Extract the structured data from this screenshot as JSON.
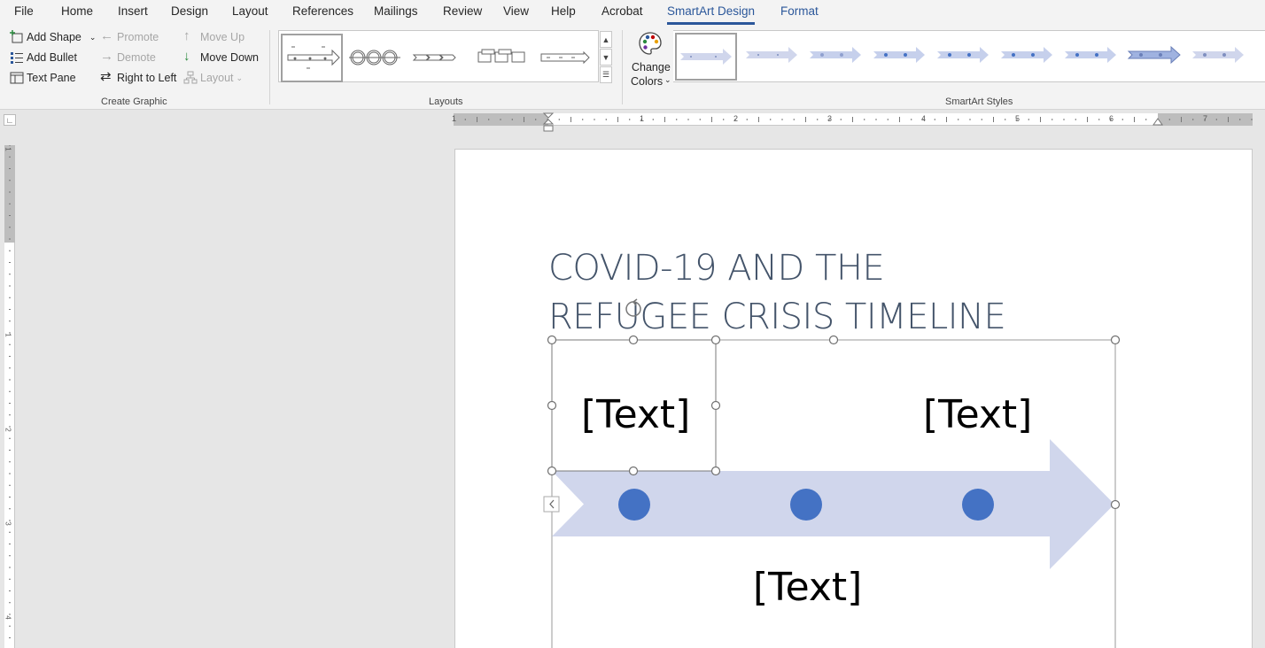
{
  "tabs": [
    "File",
    "Home",
    "Insert",
    "Design",
    "Layout",
    "References",
    "Mailings",
    "Review",
    "View",
    "Help",
    "Acrobat",
    "SmartArt Design",
    "Format"
  ],
  "create_graphic": {
    "add_shape": "Add Shape",
    "add_bullet": "Add Bullet",
    "text_pane": "Text Pane",
    "promote": "Promote",
    "demote": "Demote",
    "right_to_left": "Right to Left",
    "move_up": "Move Up",
    "move_down": "Move Down",
    "layout": "Layout",
    "label": "Create Graphic"
  },
  "layouts": {
    "label": "Layouts"
  },
  "styles": {
    "change_colors_line1": "Change",
    "change_colors_line2": "Colors",
    "label": "SmartArt Styles"
  },
  "ruler": {
    "h_numbers": [
      "1",
      "1",
      "2",
      "3",
      "4",
      "5",
      "6",
      "7"
    ],
    "v_numbers": [
      "1",
      "1",
      "2",
      "3",
      "4"
    ]
  },
  "document": {
    "title_line1": "COVID-19 AND THE",
    "title_line2": "REFUGEE CRISIS TIMELINE",
    "smartart_text": [
      "[Text]",
      "[Text]",
      "[Text]"
    ]
  },
  "colors": {
    "accent": "#2b579a",
    "arrow_fill": "#d0d6ec",
    "dot": "#4472c4",
    "title": "#44546a"
  }
}
